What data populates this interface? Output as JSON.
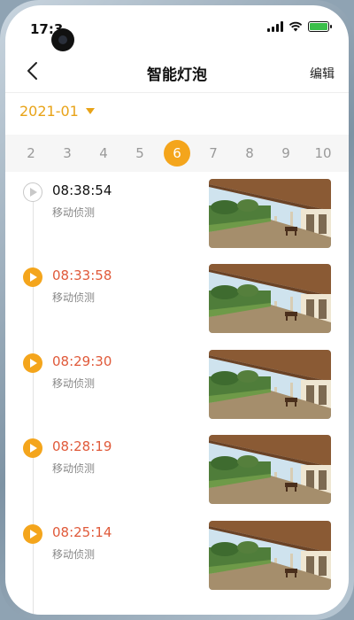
{
  "status_bar": {
    "time": "17:3"
  },
  "nav": {
    "title": "智能灯泡",
    "edit_label": "编辑"
  },
  "month": "2021-01",
  "days": [
    "2",
    "3",
    "4",
    "5",
    "6",
    "7",
    "8",
    "9",
    "10"
  ],
  "selected_day": "6",
  "events": [
    {
      "time": "08:38:54",
      "label": "移动侦测",
      "viewed": true,
      "thumbnail": "porch-camera-snapshot"
    },
    {
      "time": "08:33:58",
      "label": "移动侦测",
      "viewed": false,
      "thumbnail": "porch-camera-snapshot"
    },
    {
      "time": "08:29:30",
      "label": "移动侦测",
      "viewed": false,
      "thumbnail": "porch-camera-snapshot"
    },
    {
      "time": "08:28:19",
      "label": "移动侦测",
      "viewed": false,
      "thumbnail": "porch-camera-snapshot"
    },
    {
      "time": "08:25:14",
      "label": "移动侦测",
      "viewed": false,
      "thumbnail": "porch-camera-snapshot"
    }
  ],
  "colors": {
    "accent": "#f4a51c",
    "event_time": "#e05a3a",
    "battery": "#3bbf4a"
  },
  "icons": [
    "back-icon",
    "caret-down-icon",
    "play-icon",
    "signal-icon",
    "wifi-icon",
    "battery-icon"
  ]
}
